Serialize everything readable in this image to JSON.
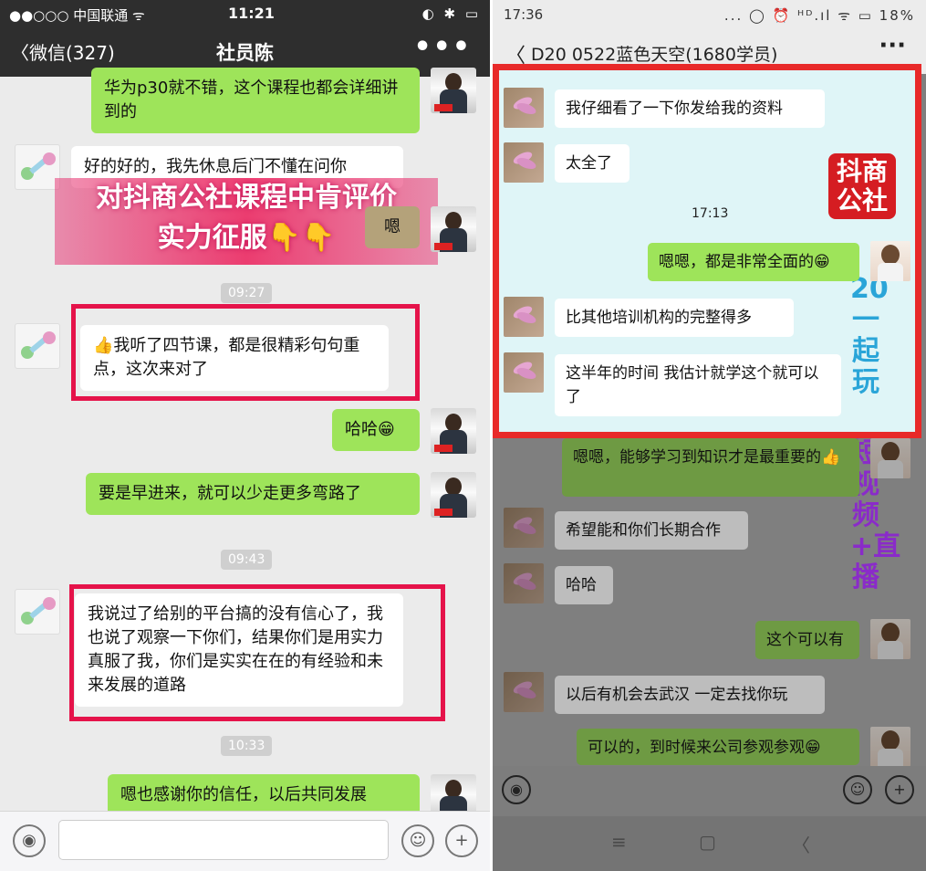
{
  "left": {
    "status": {
      "carrier": "●●○○○ 中国联通 ᯤ",
      "time": "11:21",
      "icons": "◐ ✱ ▭"
    },
    "nav": {
      "back": "〈微信(327)",
      "title": "社员陈",
      "more": "•••"
    },
    "promo": {
      "line1": "对抖商公社课程中肯评价",
      "line2": "实力征服👇👇"
    },
    "messages": [
      {
        "text": "华为p30就不错，这个课程也都会详细讲到的"
      },
      {
        "text": "好的好的，我先休息后门不懂在问你"
      },
      {
        "text": "嗯"
      },
      {
        "text": "👍我听了四节课，都是很精彩句句重点，这次来对了"
      },
      {
        "text": "哈哈😁"
      },
      {
        "text": "要是早进来，就可以少走更多弯路了"
      },
      {
        "text": "我说过了给别的平台搞的没有信心了，我也说了观察一下你们，结果你们是用实力真服了我，你们是实实在在的有经验和未来发展的道路"
      },
      {
        "text": "嗯也感谢你的信任，以后共同发展"
      }
    ],
    "timestamps": [
      "09:27",
      "09:43",
      "10:33"
    ],
    "input": {
      "voice": "◉",
      "emoji": "☺",
      "plus": "+"
    }
  },
  "right": {
    "status": {
      "time": "17:36",
      "icons": "... ◯ ⏰ ᴴᴰ.ıl ᯤ ▭ 18%"
    },
    "nav": {
      "back": "〈",
      "title": "D20 0522蓝色天空(1680学员)",
      "more": "···"
    },
    "logo": {
      "line1": "抖商",
      "line2": "公社"
    },
    "vertical_text_1": "20 一起玩",
    "vertical_text_2": "短视频+直播",
    "time_center": "17:13",
    "messages": [
      {
        "text": "我仔细看了一下你发给我的资料"
      },
      {
        "text": "太全了"
      },
      {
        "text": "嗯嗯，都是非常全面的😁"
      },
      {
        "text": "比其他培训机构的完整得多"
      },
      {
        "text": "这半年的时间 我估计就学这个就可以了"
      },
      {
        "text": "嗯嗯，能够学习到知识才是最重要的👍"
      },
      {
        "text": "希望能和你们长期合作"
      },
      {
        "text": "哈哈"
      },
      {
        "text": "这个可以有"
      },
      {
        "text": "以后有机会去武汉 一定去找你玩"
      },
      {
        "text": "可以的，到时候来公司参观参观😁"
      }
    ],
    "input": {
      "voice": "◉",
      "emoji": "☺",
      "plus": "+"
    },
    "navbar": {
      "menu": "≡",
      "home": "▢",
      "back": "〈"
    }
  }
}
